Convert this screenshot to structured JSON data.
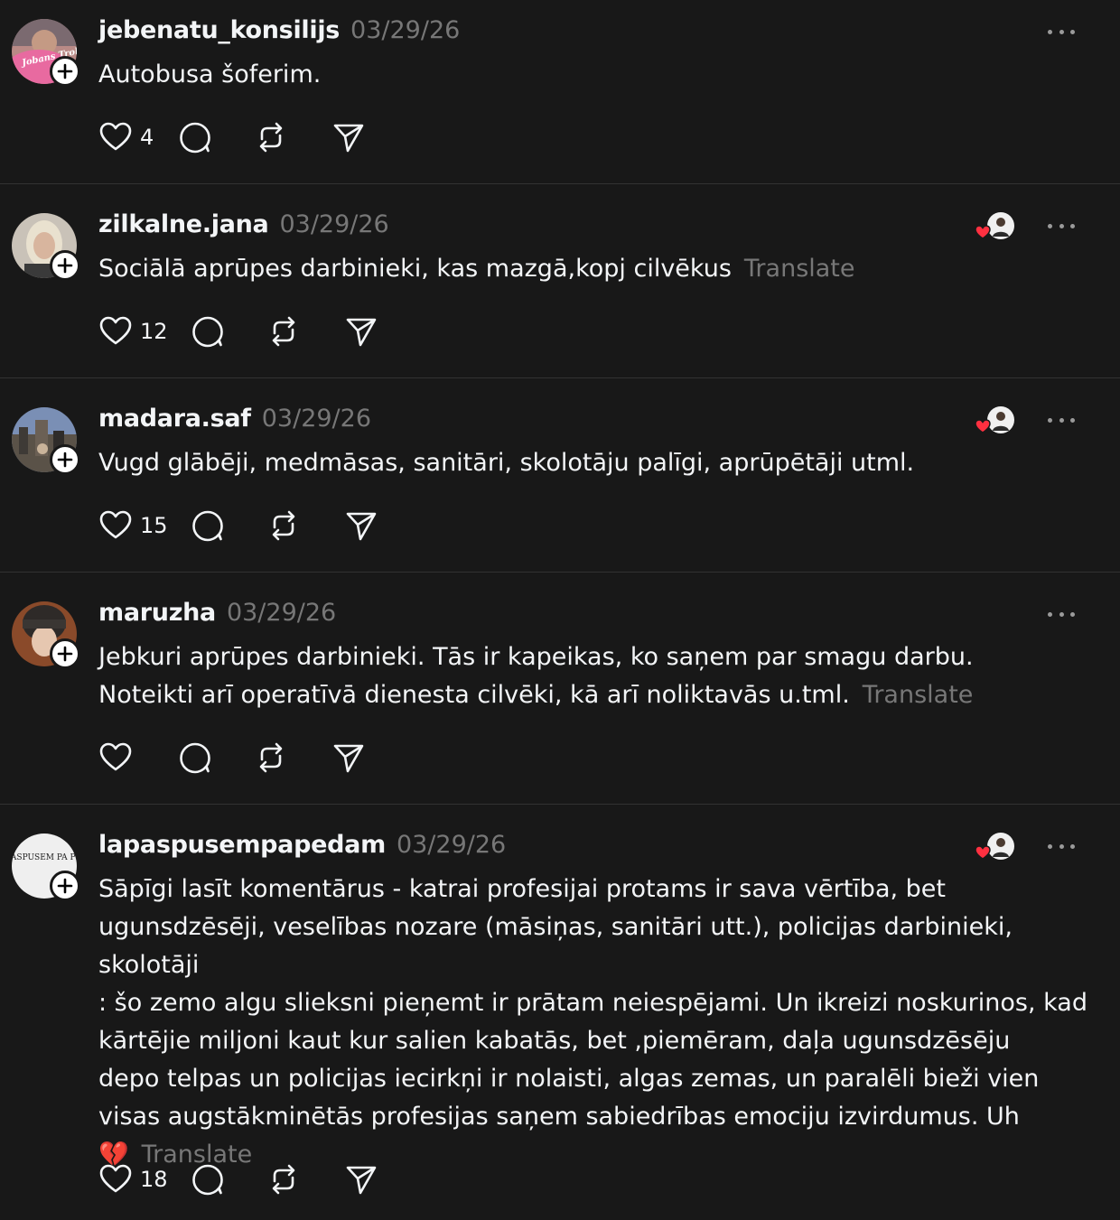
{
  "posts": [
    {
      "username": "jebenatu_konsilijs",
      "date": "03/29/26",
      "text": "Autobusa šoferim.",
      "translate": "",
      "likes": "4",
      "avatar_text": "Jobans Trolli",
      "liked_by_creator": false
    },
    {
      "username": "zilkalne.jana",
      "date": "03/29/26",
      "text": "Sociālā aprūpes darbinieki, kas mazgā,kopj cilvēkus",
      "translate": "Translate",
      "likes": "12",
      "avatar_text": "",
      "liked_by_creator": true
    },
    {
      "username": "madara.saf",
      "date": "03/29/26",
      "text": "Vugd glābēji, medmāsas, sanitāri, skolotāju palīgi, aprūpētāji utml.",
      "translate": "",
      "likes": "15",
      "avatar_text": "",
      "liked_by_creator": true
    },
    {
      "username": "maruzha",
      "date": "03/29/26",
      "text": "Jebkuri aprūpes darbinieki. Tās ir kapeikas, ko saņem par smagu darbu.\nNoteikti arī operatīvā dienesta cilvēki, kā arī noliktavās u.tml.",
      "translate": "Translate",
      "likes": "",
      "avatar_text": "",
      "liked_by_creator": false
    },
    {
      "username": "lapaspusempapedam",
      "date": "03/29/26",
      "text": "Sāpīgi lasīt komentārus - katrai profesijai protams ir sava vērtība, bet\nugunsdzēsēji, veselības nozare (māsiņas, sanitāri utt.), policijas darbinieki, skolotāji\n: šo zemo algu slieksni pieņemt ir prātam neiespējami. Un ikreizi noskurinos, kad\nkārtējie miljoni kaut kur salien kabatās, bet ,piemēram, daļa ugunsdzēsēju\ndepo telpas un policijas iecirkņi ir nolaisti, algas zemas, un paralēli bieži vien\nvisas augstākminētās profesijas saņem sabiedrības emociju izvirdumus. Uh\n💔",
      "translate": "Translate",
      "likes": "18",
      "avatar_text": "LAPASPUSEM PA PEDA",
      "liked_by_creator": true
    }
  ],
  "colors": {
    "background": "#181818",
    "text": "#f3f5f7",
    "muted": "#777777",
    "divider": "#323232",
    "heart": "#ff3040"
  },
  "icons": {
    "like": "heart-outline-icon",
    "reply": "speech-bubble-icon",
    "repost": "repost-arrows-icon",
    "share": "paper-plane-icon",
    "more": "ellipsis-icon",
    "follow": "plus-icon"
  }
}
